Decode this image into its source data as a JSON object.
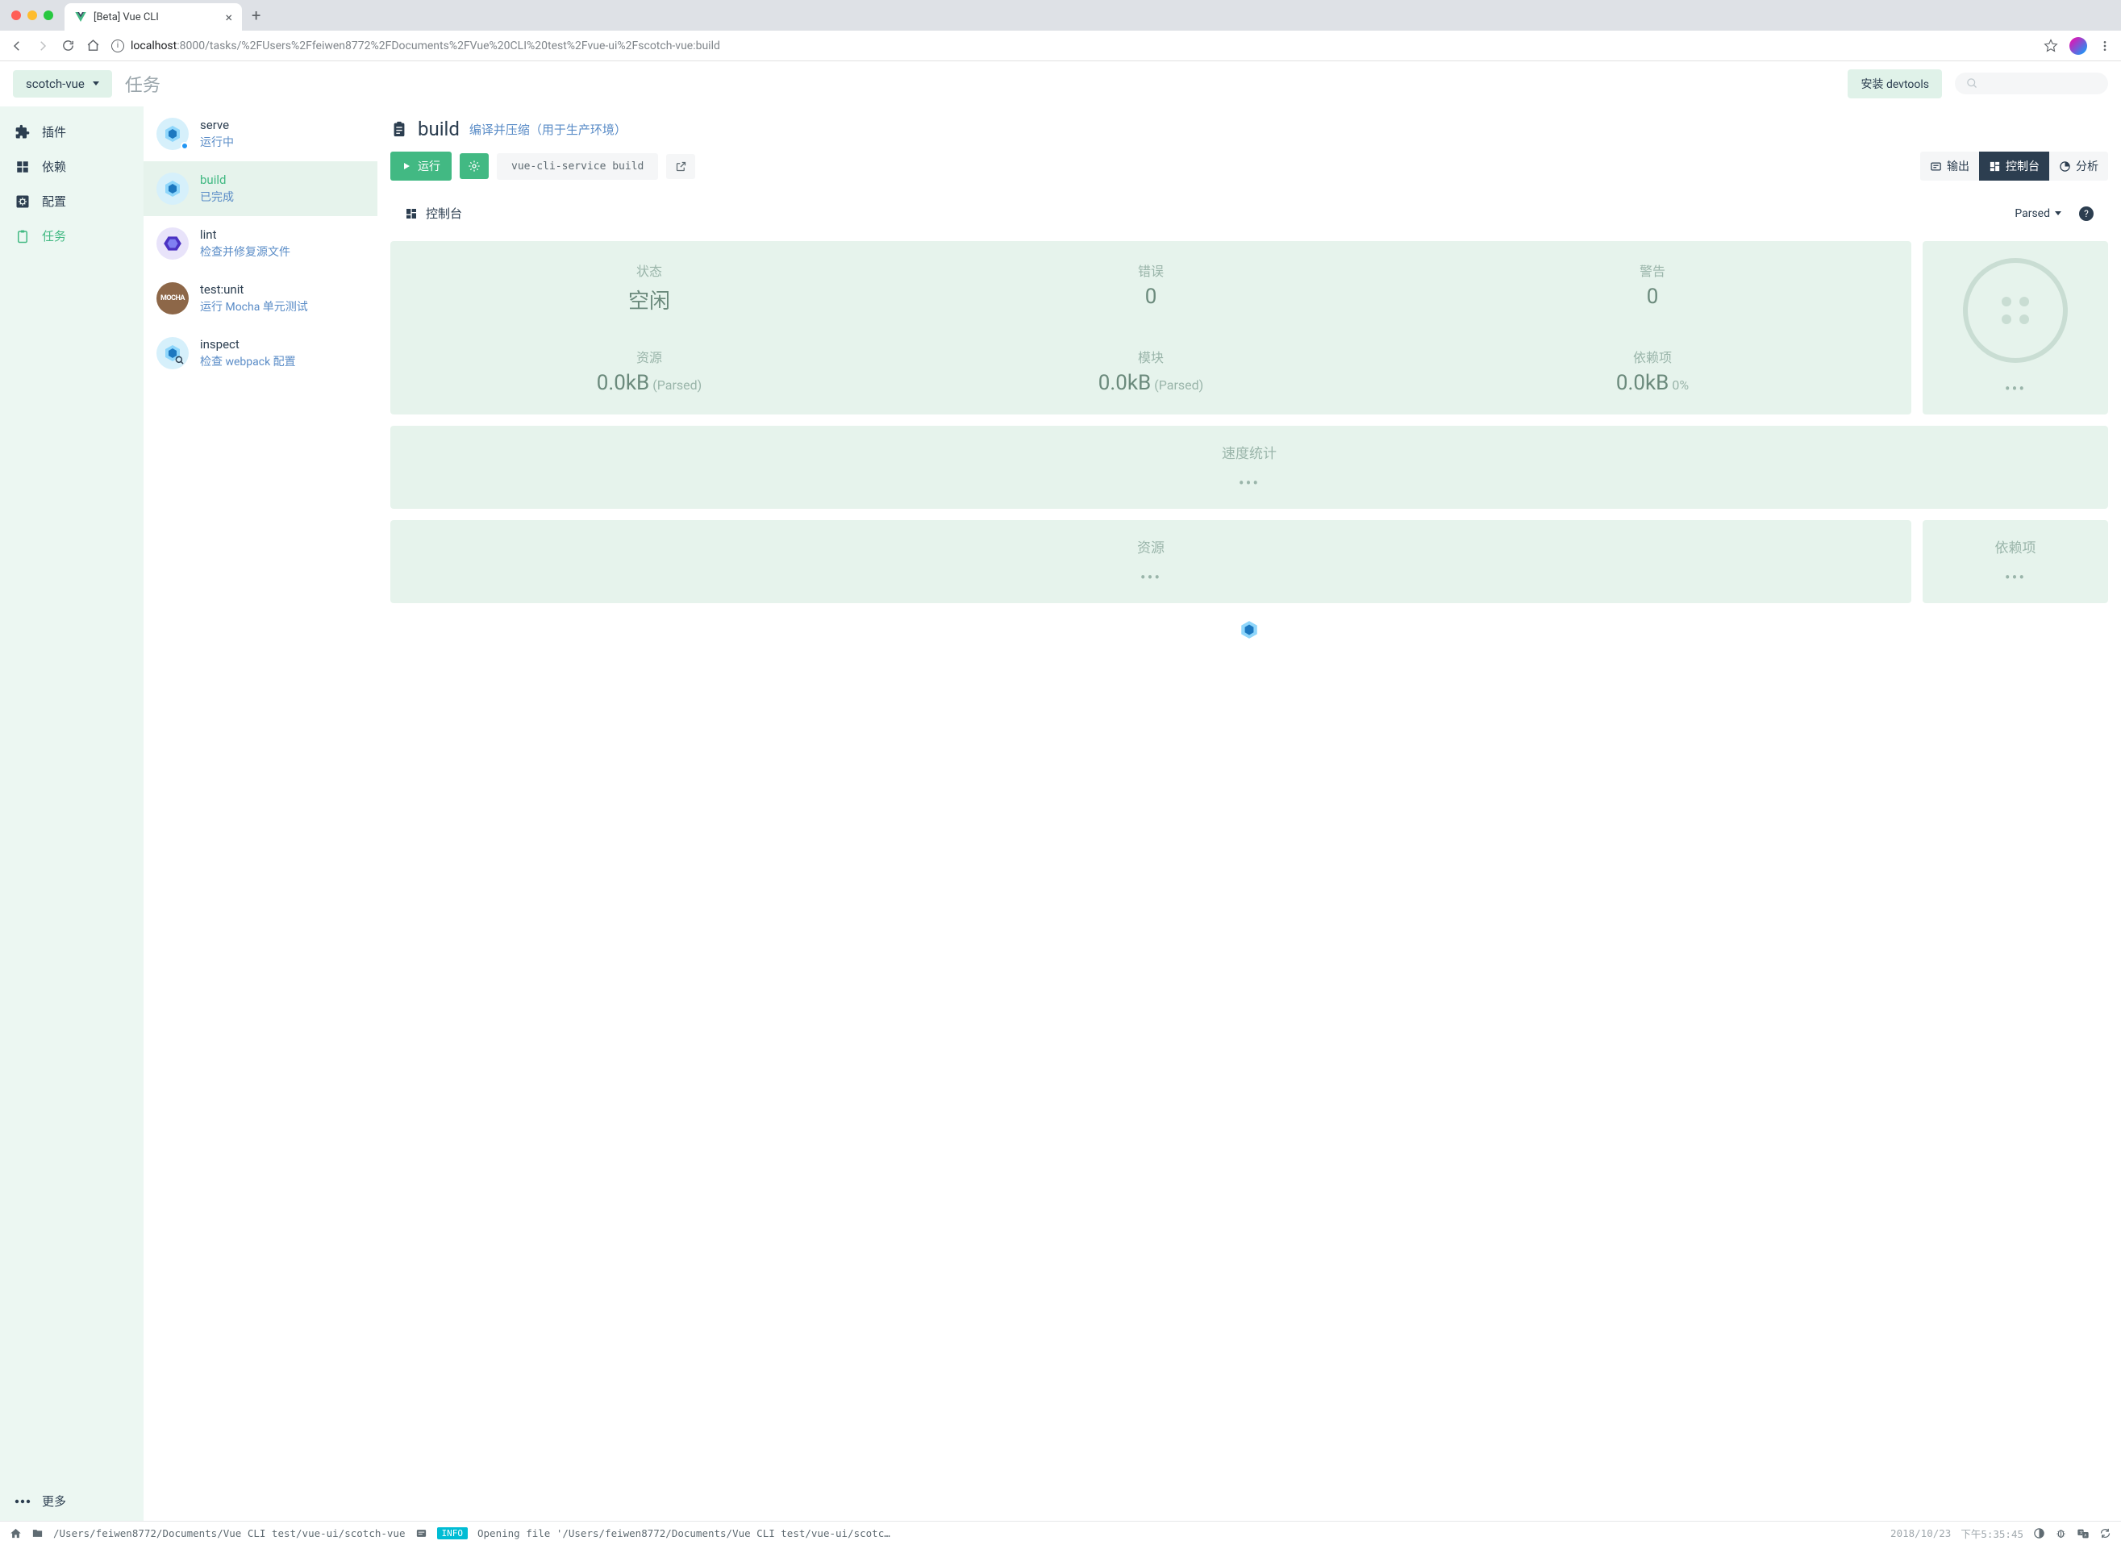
{
  "browser": {
    "tab_title": "[Beta] Vue CLI",
    "url_host": "localhost",
    "url_port_path": ":8000/tasks/%2FUsers%2Ffeiwen8772%2FDocuments%2FVue%20CLI%20test%2Fvue-ui%2Fscotch-vue:build"
  },
  "header": {
    "project_name": "scotch-vue",
    "page_title": "任务",
    "install_devtools": "安装 devtools"
  },
  "nav": {
    "plugins": "插件",
    "deps": "依赖",
    "config": "配置",
    "tasks": "任务",
    "more": "更多"
  },
  "tasks": [
    {
      "name": "serve",
      "desc": "运行中",
      "icon": "webpack",
      "running": true
    },
    {
      "name": "build",
      "desc": "已完成",
      "icon": "webpack",
      "active": true
    },
    {
      "name": "lint",
      "desc": "检查并修复源文件",
      "icon": "lint"
    },
    {
      "name": "test:unit",
      "desc": "运行 Mocha 单元测试",
      "icon": "mocha"
    },
    {
      "name": "inspect",
      "desc": "检查 webpack 配置",
      "icon": "webpack-inspect"
    }
  ],
  "content": {
    "title": "build",
    "subtitle": "编译并压缩（用于生产环境）",
    "run_label": "运行",
    "command": "vue-cli-service build",
    "view_output": "输出",
    "view_console": "控制台",
    "view_analyze": "分析",
    "console_label": "控制台",
    "parsed_label": "Parsed"
  },
  "stats": {
    "status_label": "状态",
    "status_value": "空闲",
    "errors_label": "错误",
    "errors_value": "0",
    "warnings_label": "警告",
    "warnings_value": "0",
    "assets_label": "资源",
    "assets_value": "0.0kB",
    "assets_unit": "(Parsed)",
    "modules_label": "模块",
    "modules_value": "0.0kB",
    "modules_unit": "(Parsed)",
    "deps_label": "依赖项",
    "deps_value": "0.0kB",
    "deps_unit": "0%",
    "speed_label": "速度统计",
    "resources_label": "资源",
    "dependencies_label": "依赖项"
  },
  "statusbar": {
    "path": "/Users/feiwen8772/Documents/Vue CLI test/vue-ui/scotch-vue",
    "badge": "INFO",
    "message": "Opening file '/Users/feiwen8772/Documents/Vue CLI test/vue-ui/scotc…",
    "date": "2018/10/23",
    "time": "下午5:35:45"
  }
}
